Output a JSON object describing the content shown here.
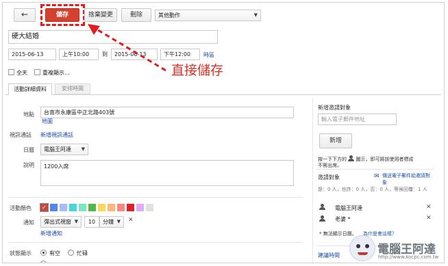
{
  "toolbar": {
    "back_icon": "back-arrow-icon",
    "save_label": "儲存",
    "discard_label": "捨棄變更",
    "delete_label": "刪除",
    "more_actions": "其他動作"
  },
  "annotation": {
    "text": "直接儲存",
    "color": "#d93025"
  },
  "event": {
    "title": "硬大結婚",
    "start_date": "2015-06-13",
    "start_time": "上午10:00",
    "to_label": "到",
    "end_date": "2015-06-13",
    "end_time": "下午12:00",
    "timezone_link": "時區",
    "allday_label": "全天",
    "repeat_label": "重複顯示..."
  },
  "tabs": [
    {
      "label": "活動詳細資料"
    },
    {
      "label": "安排時間"
    }
  ],
  "details": {
    "where_label": "地點",
    "where_value": "台南市永康區中正北路403號",
    "map_link": "地圖",
    "video_label": "視訊通話",
    "video_link": "新增視訊通話",
    "calendar_label": "日曆",
    "calendar_value": "電腦王阿達",
    "desc_label": "說明",
    "desc_value": "1200入席",
    "color_label": "活動顏色",
    "notify_label": "通知",
    "notify_type": "彈出式視窗",
    "notify_amount": "10",
    "notify_unit": "分鐘",
    "add_notify_link": "新增通知",
    "status_label": "狀態顯示",
    "status_busy": "有空",
    "status_free": "忙碌"
  },
  "colors": [
    "#c9483d",
    "#5484ed",
    "#a4bdfc",
    "#46d6db",
    "#7ae7bf",
    "#51b749",
    "#fbd75b",
    "#ffb878",
    "#ff887c",
    "#dc2127",
    "#dbadff",
    "#e1e1e1"
  ],
  "guests": {
    "section_title": "新增邀請對象",
    "input_placeholder": "輸入電子郵件地址",
    "add_button": "新增",
    "hint_text_1": "按一下下方的",
    "hint_text_2": "圖示，即可將該使用者標成",
    "hint_text_3": "不需出席。",
    "list_title": "邀請對象",
    "email_link": "傳送電子郵件給邀請對象",
    "rsvp_summary": "是：0 人，也許：0 人，否：0 人，等候回覆：1 人",
    "list": [
      {
        "name": "電腦王阿達"
      },
      {
        "name": "老婆 *"
      }
    ],
    "footnote": "* 無法顯示日曆。",
    "footnote_link": "為什麼會這樣？",
    "suggest_link": "建議時間"
  },
  "watermark": {
    "title": "電腦王阿達",
    "url": "http://www.kocpc.com.tw"
  }
}
